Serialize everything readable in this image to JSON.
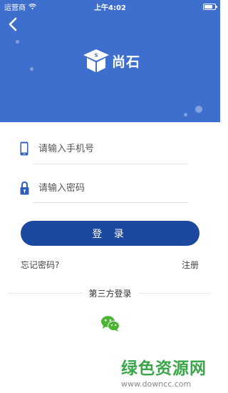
{
  "status_bar": {
    "carrier": "运营商",
    "time": "上午4:02",
    "battery_level": 0.8
  },
  "header": {
    "logo_text": "尚石",
    "logo_badge": "S"
  },
  "form": {
    "phone_placeholder": "请输入手机号",
    "password_placeholder": "请输入密码",
    "login_label": "登 录",
    "forgot_label": "忘记密码?",
    "register_label": "注册"
  },
  "third_party": {
    "title": "第三方登录",
    "providers": [
      "wechat-icon"
    ]
  },
  "watermark": {
    "title": "绿色资源网",
    "url": "www.downcc.com"
  },
  "colors": {
    "header_bg": "#3f6fce",
    "button_bg": "#1c48a0",
    "icon_blue": "#2f5fc0",
    "wechat_green": "#4cb432",
    "watermark_green": "#3aa64a"
  }
}
